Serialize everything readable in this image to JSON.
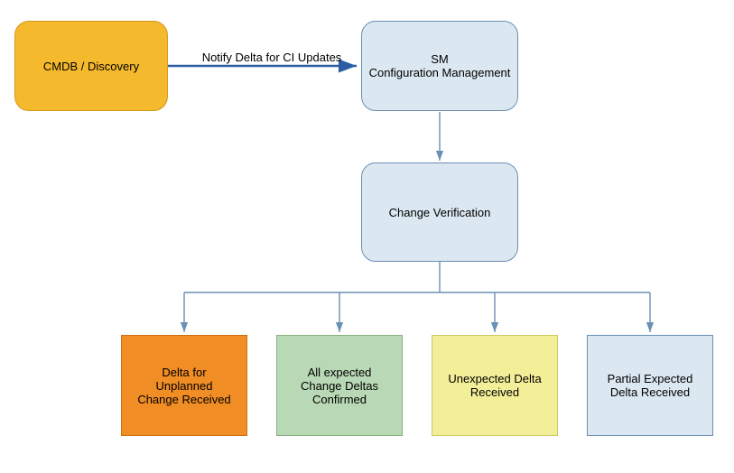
{
  "diagram": {
    "nodes": {
      "cmdb": {
        "label": "CMDB / Discovery",
        "fill": "#f5b92e",
        "stroke": "#d6991e"
      },
      "sm": {
        "label_line1": "SM",
        "label_line2": "Configuration Management",
        "fill": "#dbe8f1",
        "stroke": "#6b8fb5"
      },
      "change_verification": {
        "label": "Change Verification",
        "fill": "#dbe8f1",
        "stroke": "#6b8fb5"
      },
      "outcome_unplanned": {
        "label_line1": "Delta for",
        "label_line2": "Unplanned",
        "label_line3": "Change Received",
        "fill": "#f08d25",
        "stroke": "#c96f12"
      },
      "outcome_confirmed": {
        "label_line1": "All expected",
        "label_line2": "Change Deltas",
        "label_line3": "Confirmed",
        "fill": "#b9d8b5",
        "stroke": "#87b07f"
      },
      "outcome_unexpected": {
        "label_line1": "Unexpected Delta",
        "label_line2": "Received",
        "fill": "#f3ee98",
        "stroke": "#cdc763"
      },
      "outcome_partial": {
        "label_line1": "Partial Expected",
        "label_line2": "Delta Received",
        "fill": "#dbe8f1",
        "stroke": "#6b8fb5"
      }
    },
    "edges": {
      "cmdb_to_sm": {
        "label": "Notify Delta for CI Updates"
      }
    }
  }
}
